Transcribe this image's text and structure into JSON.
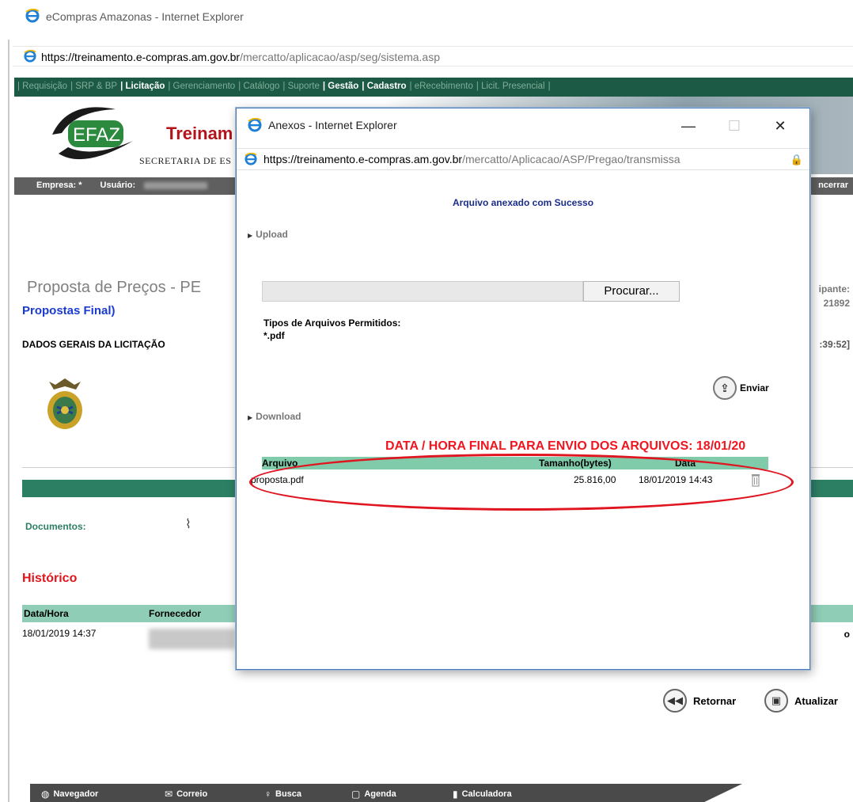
{
  "main_window": {
    "title": "eCompras Amazonas - Internet Explorer",
    "url_prefix": "https://treinamento.",
    "url_domain": "e-compras.am.gov.br",
    "url_path": "/mercatto/aplicacao/asp/seg/sistema.asp"
  },
  "topnav": {
    "items": [
      {
        "label": "| Requisição",
        "active": false
      },
      {
        "label": "| SRP & BP",
        "active": false
      },
      {
        "label": "| Licitação",
        "active": true
      },
      {
        "label": "| Gerenciamento",
        "active": false
      },
      {
        "label": "| Catálogo",
        "active": false
      },
      {
        "label": "| Suporte",
        "active": false
      },
      {
        "label": "| Gestão",
        "active": true
      },
      {
        "label": "| Cadastro",
        "active": true
      },
      {
        "label": "| eRecebimento",
        "active": false
      },
      {
        "label": "| Licit. Presencial",
        "active": false
      },
      {
        "label": "|",
        "active": false
      }
    ]
  },
  "banner": {
    "logo_text": "EFAZ",
    "treinam": "Treinam",
    "secretaria": "SECRETARIA DE ES"
  },
  "userbar": {
    "empresa": "Empresa: *",
    "usuario": "Usuário:",
    "encerrar": "ncerrar"
  },
  "page": {
    "title": "Proposta de Preços - PE",
    "subtitle": "Propostas Final)",
    "right_label": "ipante:",
    "right_number": "21892",
    "dados_gerais": "DADOS GERAIS DA LICITAÇÃO",
    "right_time": ":39:52]",
    "documentos": "Documentos:",
    "historico": "Histórico",
    "hist_headers": [
      "Data/Hora",
      "Fornecedor"
    ],
    "hist_row_date": "18/01/2019 14:37",
    "hist_row_end": "o",
    "retornar": "Retornar",
    "atualizar": "Atualizar"
  },
  "bottombar": {
    "items": [
      {
        "label": "Navegador",
        "icon": "globe-icon"
      },
      {
        "label": "Correio",
        "icon": "mail-icon"
      },
      {
        "label": "Busca",
        "icon": "search-icon"
      },
      {
        "label": "Agenda",
        "icon": "calendar-icon"
      },
      {
        "label": "Calculadora",
        "icon": "calculator-icon"
      }
    ]
  },
  "popup": {
    "title": "Anexos - Internet Explorer",
    "url_prefix": "https://treinamento.",
    "url_domain": "e-compras.am.gov.br",
    "url_path": "/mercatto/Aplicacao/ASP/Pregao/transmissa",
    "success": "Arquivo anexado com Sucesso",
    "upload_label": "Upload",
    "browse_label": "Procurar...",
    "tipos_label": "Tipos de Arquivos Permitidos:",
    "tipos_value": "*.pdf",
    "enviar": "Enviar",
    "download_label": "Download",
    "deadline": "DATA / HORA FINAL PARA ENVIO DOS ARQUIVOS: 18/01/20",
    "table_headers": {
      "arquivo": "Arquivo",
      "tamanho": "Tamanho(bytes)",
      "data": "Data"
    },
    "files": [
      {
        "name": "proposta.pdf",
        "size": "25.816,00",
        "date": "18/01/2019 14:43"
      }
    ]
  },
  "colors": {
    "nav_green": "#1c5a46",
    "table_header_green": "#8fcdb6",
    "highlight_red": "#e01520",
    "link_blue": "#1a3bd1"
  }
}
